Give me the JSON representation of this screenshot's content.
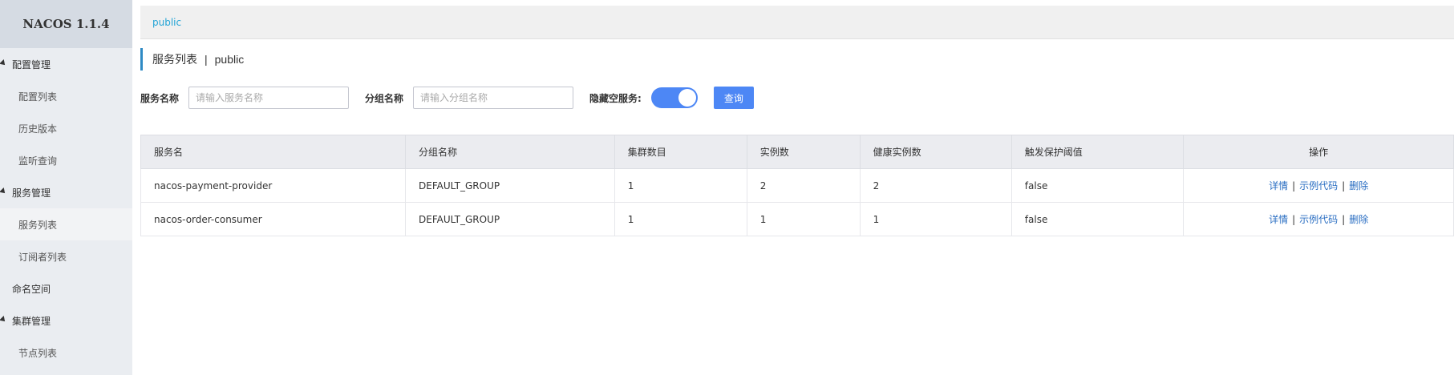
{
  "app": {
    "title": "NACOS 1.1.4"
  },
  "sidebar": {
    "groups": [
      {
        "label": "配置管理",
        "items": [
          "配置列表",
          "历史版本",
          "监听查询"
        ]
      },
      {
        "label": "服务管理",
        "items": [
          "服务列表",
          "订阅者列表"
        ]
      },
      {
        "label": "命名空间",
        "items": []
      },
      {
        "label": "集群管理",
        "items": [
          "节点列表"
        ]
      }
    ]
  },
  "breadcrumb": {
    "namespace": "public"
  },
  "page": {
    "title": "服务列表",
    "separator": "|",
    "namespace": "public"
  },
  "search": {
    "service_label": "服务名称",
    "service_placeholder": "请输入服务名称",
    "group_label": "分组名称",
    "group_placeholder": "请输入分组名称",
    "hide_empty_label": "隐藏空服务:",
    "hide_empty_on": true,
    "query_label": "查询"
  },
  "table": {
    "headers": [
      "服务名",
      "分组名称",
      "集群数目",
      "实例数",
      "健康实例数",
      "触发保护阈值",
      "操作"
    ],
    "rows": [
      [
        "nacos-payment-provider",
        "DEFAULT_GROUP",
        "1",
        "2",
        "2",
        "false"
      ],
      [
        "nacos-order-consumer",
        "DEFAULT_GROUP",
        "1",
        "1",
        "1",
        "false"
      ]
    ],
    "actions": {
      "detail": "详情",
      "sample": "示例代码",
      "delete": "删除",
      "sep": "|"
    }
  },
  "colors": {
    "accent": "#4d87f5",
    "link": "#2a6ec2",
    "breadcrumb": "#22a4d6"
  }
}
